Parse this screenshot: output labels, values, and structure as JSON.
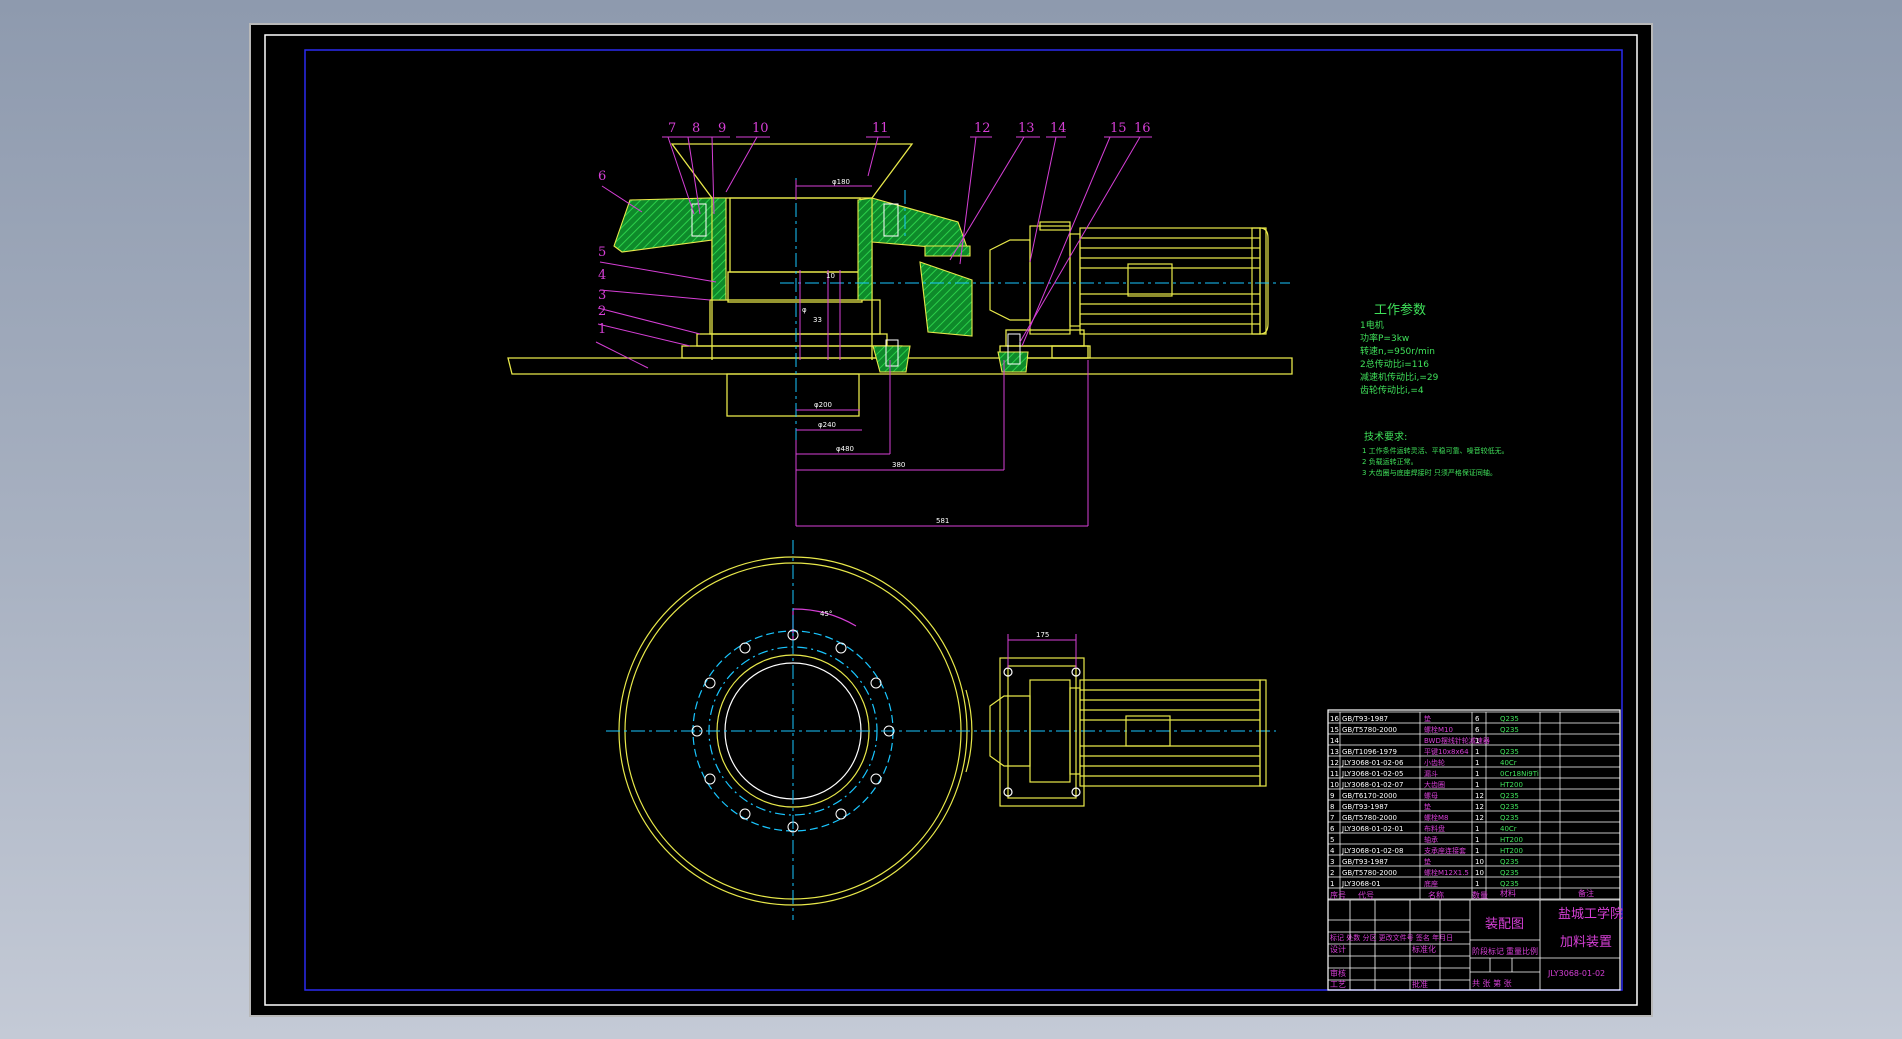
{
  "part_numbers": [
    "1",
    "2",
    "3",
    "4",
    "5",
    "6",
    "7",
    "8",
    "9",
    "10",
    "11",
    "12",
    "13",
    "14",
    "15",
    "16"
  ],
  "dims": {
    "d_top": "φ180",
    "side_a": "φ",
    "side_b": "33",
    "side_c": "10",
    "d_1": "φ200",
    "d_2": "φ240",
    "d_3": "φ480",
    "d_4": "380",
    "d_5": "581",
    "angle": "45°",
    "motor_w": "175"
  },
  "work_params": {
    "title": "工作参数",
    "lines": [
      "1电机",
      "功率P=3kw",
      "转速n,=950r/min",
      "2总传动比i=116",
      "减速机传动比i,=29",
      "齿轮传动比i,=4"
    ]
  },
  "tech_req": {
    "title": "技术要求:",
    "lines": [
      "1 工作条件运转灵活、平稳可靠、噪音较低无。",
      "2 负载运转正常。",
      "3 大齿圈与底座焊接时 只须严格保证同轴。"
    ]
  },
  "bom": [
    {
      "no": "16",
      "code": "GB/T93-1987",
      "name": "垫",
      "qty": "6",
      "mat": "Q235"
    },
    {
      "no": "15",
      "code": "GB/T5780-2000",
      "name": "螺栓M10",
      "qty": "6",
      "mat": "Q235"
    },
    {
      "no": "14",
      "code": "",
      "name": "BWD摆线针轮减速器",
      "qty": "1",
      "mat": ""
    },
    {
      "no": "13",
      "code": "GB/T1096-1979",
      "name": "平键10x8x64",
      "qty": "1",
      "mat": "Q235"
    },
    {
      "no": "12",
      "code": "JLY3068-01-02-06",
      "name": "小齿轮",
      "qty": "1",
      "mat": "40Cr"
    },
    {
      "no": "11",
      "code": "JLY3068-01-02-05",
      "name": "漏斗",
      "qty": "1",
      "mat": "0Cr18Ni9Ti"
    },
    {
      "no": "10",
      "code": "JLY3068-01-02-07",
      "name": "大齿圈",
      "qty": "1",
      "mat": "HT200"
    },
    {
      "no": "9",
      "code": "GB/T6170-2000",
      "name": "螺母",
      "qty": "12",
      "mat": "Q235"
    },
    {
      "no": "8",
      "code": "GB/T93-1987",
      "name": "垫",
      "qty": "12",
      "mat": "Q235"
    },
    {
      "no": "7",
      "code": "GB/T5780-2000",
      "name": "螺栓M8",
      "qty": "12",
      "mat": "Q235"
    },
    {
      "no": "6",
      "code": "JLY3068-01-02-01",
      "name": "布料盘",
      "qty": "1",
      "mat": "40Cr"
    },
    {
      "no": "5",
      "code": "",
      "name": "轴承",
      "qty": "1",
      "mat": "HT200"
    },
    {
      "no": "4",
      "code": "JLY3068-01-02-08",
      "name": "支承座连接套",
      "qty": "1",
      "mat": "HT200"
    },
    {
      "no": "3",
      "code": "GB/T93-1987",
      "name": "垫",
      "qty": "10",
      "mat": "Q235"
    },
    {
      "no": "2",
      "code": "GB/T5780-2000",
      "name": "螺栓M12X1.5",
      "qty": "10",
      "mat": "Q235"
    },
    {
      "no": "1",
      "code": "JLY3068-01",
      "name": "底座",
      "qty": "1",
      "mat": "Q235"
    }
  ],
  "title_block": {
    "hdr_no": "序号",
    "hdr_code": "代号",
    "hdr_name": "名称",
    "hdr_qty": "数量",
    "hdr_mat": "材料",
    "hdr_note": "备注",
    "drawing_type": "装配图",
    "school": "盐城工学院",
    "part_name": "加料装置",
    "drawing_no": "JLY3068-01-02",
    "designer": "设计",
    "checker": "审核",
    "process": "工艺",
    "approve": "批准",
    "std": "标准化",
    "stage_label": "阶段标记",
    "weight": "重量",
    "scale": "比例",
    "sheets": "共 张 第 张",
    "rev_row": "标记 处数 分区 更改文件号 签名 年月日"
  }
}
